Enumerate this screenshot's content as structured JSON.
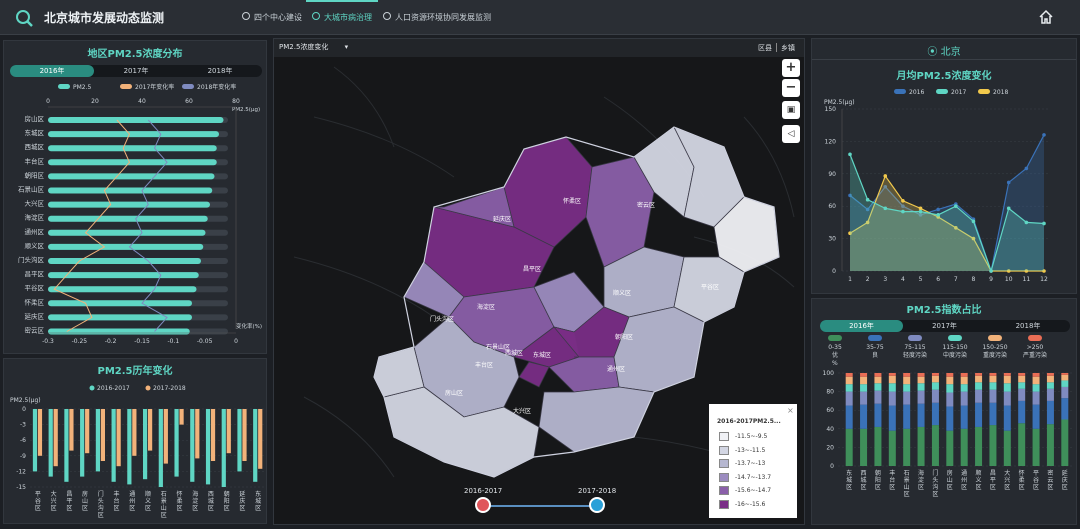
{
  "app": {
    "title": "北京城市发展动态监测"
  },
  "nav": {
    "tabs": [
      {
        "label": "四个中心建设"
      },
      {
        "label": "大城市病治理"
      },
      {
        "label": "人口资源环境协同发展监测"
      }
    ]
  },
  "left_top": {
    "title": "地区PM2.5浓度分布",
    "years": [
      "2016年",
      "2017年",
      "2018年"
    ],
    "legend": [
      "PM2.5",
      "2017年变化率",
      "2018年变化率"
    ],
    "unit": "PM2.5(μg)",
    "axis_top": [
      "0",
      "20",
      "40",
      "60",
      "80"
    ],
    "axis_bottom": [
      "-0.3",
      "-0.25",
      "-0.2",
      "-0.15",
      "-0.1",
      "-0.05",
      "0"
    ],
    "axis_bottom_label": "变化率(%)",
    "districts": [
      "房山区",
      "东城区",
      "西城区",
      "丰台区",
      "朝阳区",
      "石景山区",
      "大兴区",
      "海淀区",
      "通州区",
      "顺义区",
      "门头沟区",
      "昌平区",
      "平谷区",
      "怀柔区",
      "延庆区",
      "密云区"
    ]
  },
  "left_bottom": {
    "title": "PM2.5历年变化",
    "legend": [
      "2016-2017",
      "2017-2018"
    ],
    "unit": "PM2.5(μg)",
    "yticks": [
      "0",
      "-3",
      "-6",
      "-9",
      "-12",
      "-15"
    ],
    "districts": [
      "平谷区",
      "大兴区",
      "昌平区",
      "房山区",
      "门头沟区",
      "丰台区",
      "通州区",
      "顺义区",
      "石景山区",
      "怀柔区",
      "海淀区",
      "西城区",
      "朝阳区",
      "延庆区",
      "东城区"
    ]
  },
  "map": {
    "select": "PM2.5浓度变化",
    "toggle_a": "区县",
    "toggle_b": "乡镇",
    "zoom_in": "+",
    "zoom_out": "−",
    "labels": [
      "延庆区",
      "怀柔区",
      "密云区",
      "昌平区",
      "顺义区",
      "平谷区",
      "门头沟区",
      "海淀区",
      "朝阳区",
      "石景山区",
      "西城区",
      "东城区",
      "丰台区",
      "通州区",
      "大兴区",
      "房山区"
    ],
    "timeline_start": "2016-2017",
    "timeline_end": "2017-2018",
    "legend_title": "2016-2017PM2.5...",
    "legend_close": "×",
    "legend_items": [
      {
        "label": "-11.5~-9.5",
        "color": "#f1f2f6"
      },
      {
        "label": "-13~-11.5",
        "color": "#d3d6e3"
      },
      {
        "label": "-13.7~-13",
        "color": "#b6b7d0"
      },
      {
        "label": "-14.7~-13.7",
        "color": "#9c8cc0"
      },
      {
        "label": "-15.6~-14.7",
        "color": "#8a5fa9"
      },
      {
        "label": "-16~-15.6",
        "color": "#7a2e86"
      }
    ]
  },
  "right_top": {
    "location": "北京",
    "title": "月均PM2.5浓度变化",
    "unit": "PM2.5(μg)",
    "series_names": [
      "2016",
      "2017",
      "2018"
    ],
    "yticks": [
      "0",
      "30",
      "60",
      "90",
      "120",
      "150"
    ],
    "months": [
      "1",
      "2",
      "3",
      "4",
      "5",
      "6",
      "7",
      "8",
      "9",
      "10",
      "11",
      "12"
    ]
  },
  "right_bottom": {
    "title": "PM2.5指数占比",
    "years": [
      "2016年",
      "2017年",
      "2018年"
    ],
    "legend": [
      {
        "range": "0-35",
        "name": "优",
        "color": "#3f8f5a"
      },
      {
        "range": "35-75",
        "name": "良",
        "color": "#3a72b8"
      },
      {
        "range": "75-115",
        "name": "轻度污染",
        "color": "#7f8bc0"
      },
      {
        "range": "115-150",
        "name": "中度污染",
        "color": "#5fd6c4"
      },
      {
        "range": "150-250",
        "name": "重度污染",
        "color": "#f2b27a"
      },
      {
        "range": ">250",
        "name": "严重污染",
        "color": "#e96d55"
      }
    ],
    "unit": "%",
    "yticks": [
      "0",
      "20",
      "40",
      "60",
      "80",
      "100"
    ],
    "districts": [
      "东城区",
      "西城区",
      "朝阳区",
      "丰台区",
      "石景山区",
      "海淀区",
      "门头沟区",
      "房山区",
      "通州区",
      "顺义区",
      "昌平区",
      "大兴区",
      "怀柔区",
      "平谷区",
      "密云区",
      "延庆区"
    ]
  },
  "chart_data": [
    {
      "type": "bar",
      "title": "地区PM2.5浓度分布",
      "categories": [
        "房山区",
        "东城区",
        "西城区",
        "丰台区",
        "朝阳区",
        "石景山区",
        "大兴区",
        "海淀区",
        "通州区",
        "顺义区",
        "门头沟区",
        "昌平区",
        "平谷区",
        "怀柔区",
        "延庆区",
        "密云区"
      ],
      "series": [
        {
          "name": "PM2.5",
          "values": [
            78,
            76,
            75,
            75,
            74,
            73,
            72,
            71,
            70,
            69,
            68,
            67,
            66,
            64,
            64,
            63
          ]
        },
        {
          "name": "2017年变化率",
          "values": [
            -0.19,
            -0.17,
            -0.18,
            -0.17,
            -0.19,
            -0.21,
            -0.2,
            -0.22,
            -0.24,
            -0.21,
            -0.25,
            -0.27,
            -0.29,
            -0.24,
            -0.23,
            -0.27
          ]
        },
        {
          "name": "2018年变化率",
          "values": [
            -0.14,
            -0.12,
            -0.13,
            -0.11,
            -0.13,
            -0.15,
            -0.14,
            -0.16,
            -0.15,
            -0.17,
            -0.14,
            -0.12,
            -0.13,
            -0.15,
            -0.11,
            -0.13
          ]
        }
      ],
      "xlim": [
        0,
        80
      ]
    },
    {
      "type": "bar",
      "title": "PM2.5历年变化",
      "categories": [
        "平谷区",
        "大兴区",
        "昌平区",
        "房山区",
        "门头沟区",
        "丰台区",
        "通州区",
        "顺义区",
        "石景山区",
        "怀柔区",
        "海淀区",
        "西城区",
        "朝阳区",
        "延庆区",
        "东城区"
      ],
      "series": [
        {
          "name": "2016-2017",
          "values": [
            -12,
            -13,
            -14,
            -13,
            -12,
            -14,
            -14.5,
            -13.5,
            -15,
            -13,
            -14,
            -14.5,
            -15,
            -12,
            -14
          ]
        },
        {
          "name": "2017-2018",
          "values": [
            -9,
            -11,
            -8,
            -8.5,
            -10,
            -11,
            -9,
            -8,
            -10.5,
            -3,
            -9.5,
            -10,
            -8.5,
            -10,
            -11.5
          ]
        }
      ],
      "ylim": [
        -15,
        0
      ]
    },
    {
      "type": "line",
      "title": "月均PM2.5浓度变化",
      "x": [
        1,
        2,
        3,
        4,
        5,
        6,
        7,
        8,
        9,
        10,
        11,
        12
      ],
      "series": [
        {
          "name": "2016",
          "values": [
            70,
            57,
            78,
            60,
            52,
            57,
            62,
            48,
            0,
            82,
            95,
            126
          ]
        },
        {
          "name": "2017",
          "values": [
            108,
            66,
            58,
            55,
            55,
            52,
            60,
            46,
            0,
            58,
            45,
            44
          ]
        },
        {
          "name": "2018",
          "values": [
            35,
            45,
            88,
            65,
            58,
            50,
            40,
            30,
            0,
            0,
            0,
            0
          ]
        }
      ],
      "ylim": [
        0,
        150
      ]
    },
    {
      "type": "bar",
      "title": "PM2.5指数占比",
      "categories": [
        "东城区",
        "西城区",
        "朝阳区",
        "丰台区",
        "石景山区",
        "海淀区",
        "门头沟区",
        "房山区",
        "通州区",
        "顺义区",
        "昌平区",
        "大兴区",
        "怀柔区",
        "平谷区",
        "密云区",
        "延庆区"
      ],
      "series": [
        {
          "name": "0-35",
          "values": [
            40,
            40,
            42,
            38,
            40,
            42,
            44,
            38,
            40,
            42,
            44,
            38,
            46,
            40,
            45,
            50
          ]
        },
        {
          "name": "35-75",
          "values": [
            25,
            26,
            25,
            27,
            26,
            25,
            24,
            26,
            25,
            26,
            24,
            27,
            24,
            26,
            25,
            23
          ]
        },
        {
          "name": "75-115",
          "values": [
            15,
            14,
            14,
            15,
            14,
            14,
            14,
            15,
            15,
            14,
            14,
            15,
            13,
            14,
            13,
            12
          ]
        },
        {
          "name": "115-150",
          "values": [
            8,
            8,
            8,
            9,
            8,
            8,
            8,
            9,
            8,
            8,
            8,
            9,
            7,
            8,
            7,
            7
          ]
        },
        {
          "name": "150-250",
          "values": [
            8,
            8,
            7,
            8,
            8,
            7,
            7,
            8,
            8,
            7,
            7,
            8,
            7,
            8,
            7,
            6
          ]
        },
        {
          "name": ">250",
          "values": [
            4,
            4,
            4,
            3,
            4,
            4,
            3,
            4,
            4,
            3,
            3,
            3,
            3,
            4,
            3,
            2
          ]
        }
      ],
      "ylim": [
        0,
        100
      ]
    }
  ]
}
